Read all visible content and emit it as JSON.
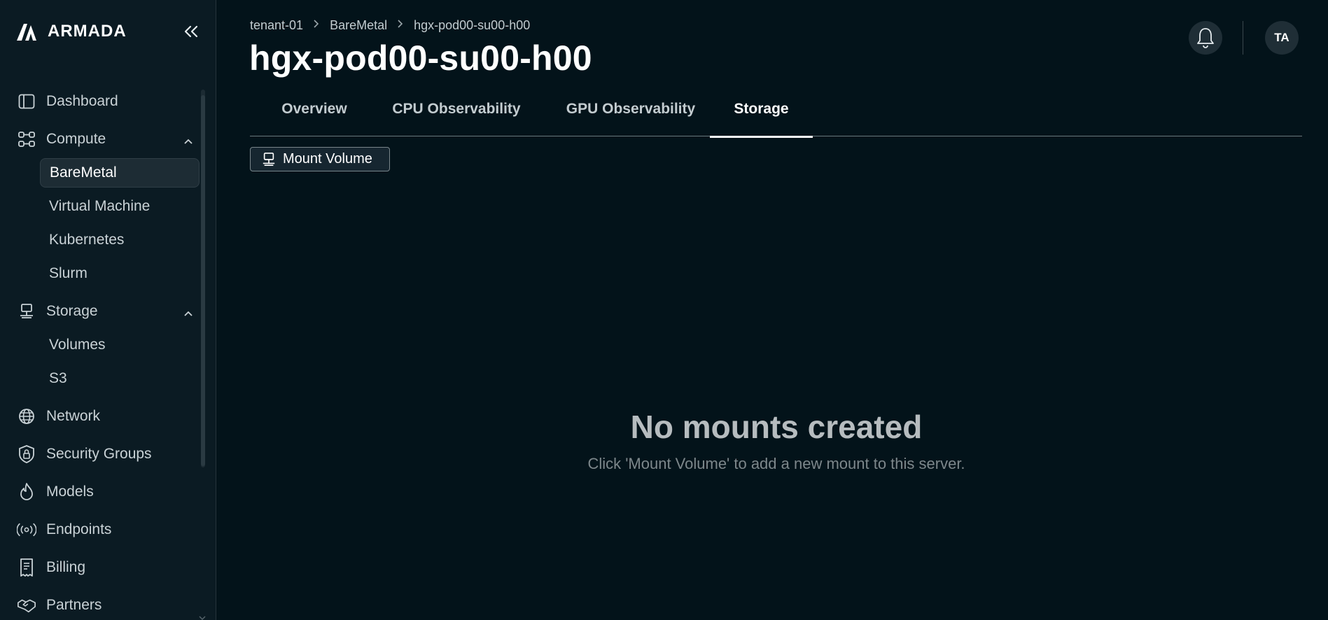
{
  "app": {
    "brand": "ARMADA"
  },
  "sidebar": {
    "items": [
      {
        "label": "Dashboard",
        "icon": "dashboard-icon"
      },
      {
        "label": "Compute",
        "icon": "compute-icon",
        "expanded": true,
        "children": [
          {
            "label": "BareMetal",
            "active": true
          },
          {
            "label": "Virtual Machine"
          },
          {
            "label": "Kubernetes"
          },
          {
            "label": "Slurm"
          }
        ]
      },
      {
        "label": "Storage",
        "icon": "storage-icon",
        "expanded": true,
        "children": [
          {
            "label": "Volumes"
          },
          {
            "label": "S3"
          }
        ]
      },
      {
        "label": "Network",
        "icon": "globe-icon"
      },
      {
        "label": "Security Groups",
        "icon": "lock-icon"
      },
      {
        "label": "Models",
        "icon": "flame-icon"
      },
      {
        "label": "Endpoints",
        "icon": "broadcast-icon"
      },
      {
        "label": "Billing",
        "icon": "receipt-icon"
      },
      {
        "label": "Partners",
        "icon": "handshake-icon"
      }
    ]
  },
  "header": {
    "breadcrumb": [
      "tenant-01",
      "BareMetal",
      "hgx-pod00-su00-h00"
    ],
    "title": "hgx-pod00-su00-h00",
    "avatar_initials": "TA"
  },
  "tabs": [
    {
      "label": "Overview"
    },
    {
      "label": "CPU Observability"
    },
    {
      "label": "GPU Observability"
    },
    {
      "label": "Storage",
      "active": true
    }
  ],
  "main": {
    "mount_button_label": "Mount Volume",
    "empty_title": "No mounts created",
    "empty_subtitle": "Click 'Mount Volume' to add a new mount to this server."
  },
  "colors": {
    "background": "#03131a",
    "sidebar": "#0b1b23",
    "active_item": "#1d2c34",
    "text": "#ffffff",
    "muted": "#7d878b"
  }
}
